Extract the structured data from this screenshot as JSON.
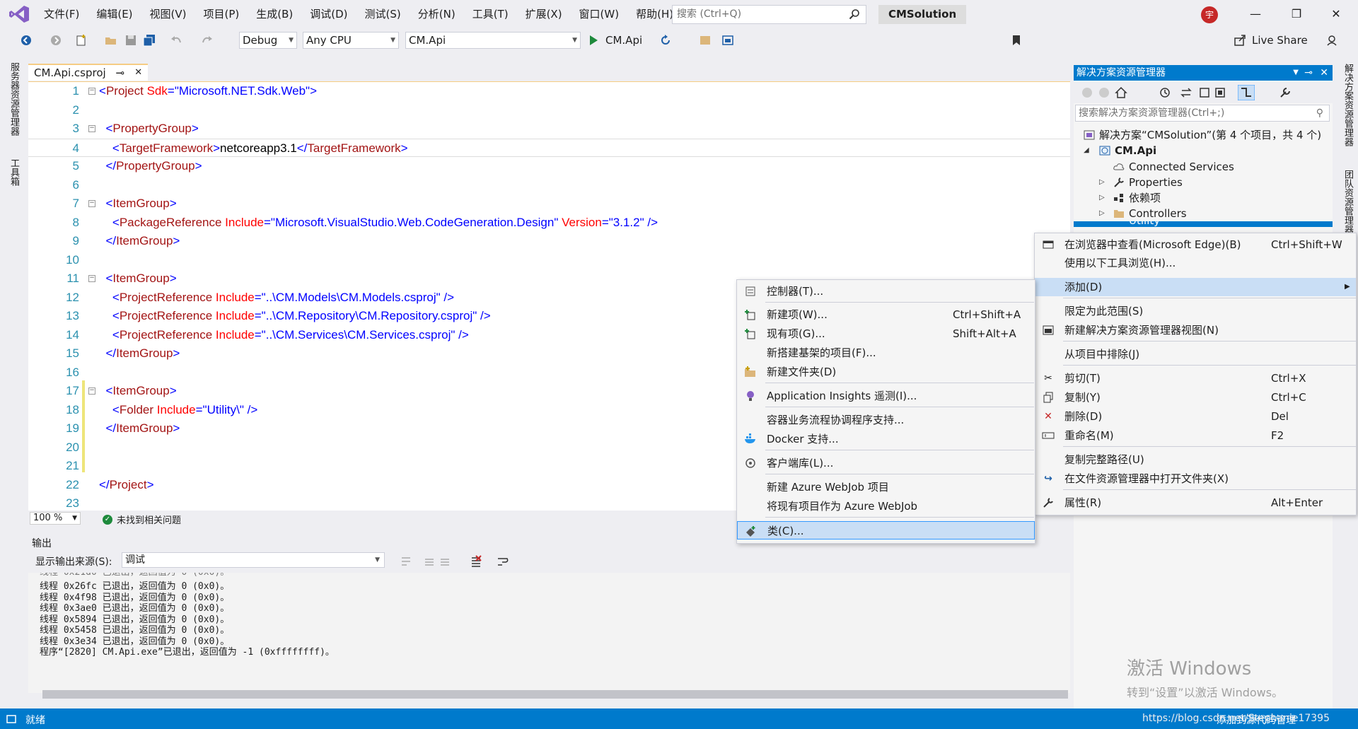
{
  "menubar": {
    "items": [
      "文件(F)",
      "编辑(E)",
      "视图(V)",
      "项目(P)",
      "生成(B)",
      "调试(D)",
      "测试(S)",
      "分析(N)",
      "工具(T)",
      "扩展(X)",
      "窗口(W)",
      "帮助(H)"
    ],
    "search_placeholder": "搜索 (Ctrl+Q)",
    "solution_name": "CMSolution",
    "user_initial": "宇"
  },
  "toolbar": {
    "config": "Debug",
    "platform": "Any CPU",
    "startup_project": "CM.Api",
    "run_label": "CM.Api",
    "live_share": "Live Share"
  },
  "left_strip": {
    "server_explorer": "服务器资源管理器",
    "toolbox": "工具箱"
  },
  "right_strip": {
    "solution_explorer": "解决方案资源管理器",
    "team_explorer": "团队资源管理器"
  },
  "editor": {
    "tab_name": "CM.Api.csproj",
    "lines": [
      {
        "n": "1",
        "parts": [
          [
            "pun",
            "<"
          ],
          [
            "tag",
            "Project"
          ],
          [
            "txt",
            " "
          ],
          [
            "attr",
            "Sdk"
          ],
          [
            "pun",
            "=\""
          ],
          [
            "val",
            "Microsoft.NET.Sdk.Web"
          ],
          [
            "pun",
            "\">"
          ]
        ]
      },
      {
        "n": "2",
        "parts": []
      },
      {
        "n": "3",
        "parts": [
          [
            "txt",
            "  "
          ],
          [
            "pun",
            "<"
          ],
          [
            "tag",
            "PropertyGroup"
          ],
          [
            "pun",
            ">"
          ]
        ]
      },
      {
        "n": "4",
        "parts": [
          [
            "txt",
            "    "
          ],
          [
            "pun",
            "<"
          ],
          [
            "tag",
            "TargetFramework"
          ],
          [
            "pun",
            ">"
          ],
          [
            "txt",
            "netcoreapp3.1"
          ],
          [
            "pun",
            "</"
          ],
          [
            "tag",
            "TargetFramework"
          ],
          [
            "pun",
            ">"
          ]
        ]
      },
      {
        "n": "5",
        "parts": [
          [
            "txt",
            "  "
          ],
          [
            "pun",
            "</"
          ],
          [
            "tag",
            "PropertyGroup"
          ],
          [
            "pun",
            ">"
          ]
        ]
      },
      {
        "n": "6",
        "parts": []
      },
      {
        "n": "7",
        "parts": [
          [
            "txt",
            "  "
          ],
          [
            "pun",
            "<"
          ],
          [
            "tag",
            "ItemGroup"
          ],
          [
            "pun",
            ">"
          ]
        ]
      },
      {
        "n": "8",
        "parts": [
          [
            "txt",
            "    "
          ],
          [
            "pun",
            "<"
          ],
          [
            "tag",
            "PackageReference"
          ],
          [
            "txt",
            " "
          ],
          [
            "attr",
            "Include"
          ],
          [
            "pun",
            "=\""
          ],
          [
            "val",
            "Microsoft.VisualStudio.Web.CodeGeneration.Design"
          ],
          [
            "pun",
            "\""
          ],
          [
            "txt",
            " "
          ],
          [
            "attr",
            "Version"
          ],
          [
            "pun",
            "=\""
          ],
          [
            "val",
            "3.1.2"
          ],
          [
            "pun",
            "\" />"
          ]
        ]
      },
      {
        "n": "9",
        "parts": [
          [
            "txt",
            "  "
          ],
          [
            "pun",
            "</"
          ],
          [
            "tag",
            "ItemGroup"
          ],
          [
            "pun",
            ">"
          ]
        ]
      },
      {
        "n": "10",
        "parts": []
      },
      {
        "n": "11",
        "parts": [
          [
            "txt",
            "  "
          ],
          [
            "pun",
            "<"
          ],
          [
            "tag",
            "ItemGroup"
          ],
          [
            "pun",
            ">"
          ]
        ]
      },
      {
        "n": "12",
        "parts": [
          [
            "txt",
            "    "
          ],
          [
            "pun",
            "<"
          ],
          [
            "tag",
            "ProjectReference"
          ],
          [
            "txt",
            " "
          ],
          [
            "attr",
            "Include"
          ],
          [
            "pun",
            "=\""
          ],
          [
            "val",
            "..\\CM.Models\\CM.Models.csproj"
          ],
          [
            "pun",
            "\" />"
          ]
        ]
      },
      {
        "n": "13",
        "parts": [
          [
            "txt",
            "    "
          ],
          [
            "pun",
            "<"
          ],
          [
            "tag",
            "ProjectReference"
          ],
          [
            "txt",
            " "
          ],
          [
            "attr",
            "Include"
          ],
          [
            "pun",
            "=\""
          ],
          [
            "val",
            "..\\CM.Repository\\CM.Repository.csproj"
          ],
          [
            "pun",
            "\" />"
          ]
        ]
      },
      {
        "n": "14",
        "parts": [
          [
            "txt",
            "    "
          ],
          [
            "pun",
            "<"
          ],
          [
            "tag",
            "ProjectReference"
          ],
          [
            "txt",
            " "
          ],
          [
            "attr",
            "Include"
          ],
          [
            "pun",
            "=\""
          ],
          [
            "val",
            "..\\CM.Services\\CM.Services.csproj"
          ],
          [
            "pun",
            "\" />"
          ]
        ]
      },
      {
        "n": "15",
        "parts": [
          [
            "txt",
            "  "
          ],
          [
            "pun",
            "</"
          ],
          [
            "tag",
            "ItemGroup"
          ],
          [
            "pun",
            ">"
          ]
        ]
      },
      {
        "n": "16",
        "parts": []
      },
      {
        "n": "17",
        "parts": [
          [
            "txt",
            "  "
          ],
          [
            "pun",
            "<"
          ],
          [
            "tag",
            "ItemGroup"
          ],
          [
            "pun",
            ">"
          ]
        ]
      },
      {
        "n": "18",
        "parts": [
          [
            "txt",
            "    "
          ],
          [
            "pun",
            "<"
          ],
          [
            "tag",
            "Folder"
          ],
          [
            "txt",
            " "
          ],
          [
            "attr",
            "Include"
          ],
          [
            "pun",
            "=\""
          ],
          [
            "val",
            "Utility\\"
          ],
          [
            "pun",
            "\" />"
          ]
        ]
      },
      {
        "n": "19",
        "parts": [
          [
            "txt",
            "  "
          ],
          [
            "pun",
            "</"
          ],
          [
            "tag",
            "ItemGroup"
          ],
          [
            "pun",
            ">"
          ]
        ]
      },
      {
        "n": "20",
        "parts": []
      },
      {
        "n": "21",
        "parts": []
      },
      {
        "n": "22",
        "parts": [
          [
            "pun",
            "</"
          ],
          [
            "tag",
            "Project"
          ],
          [
            "pun",
            ">"
          ]
        ]
      },
      {
        "n": "23",
        "parts": []
      }
    ],
    "zoom": "100 %",
    "issues": "未找到相关问题"
  },
  "output": {
    "title": "输出",
    "source_label": "显示输出来源(S):",
    "source_value": "调试",
    "lines": [
      "线程 0x26fc 已退出，返回值为 0 (0x0)。",
      "线程 0x4f98 已退出，返回值为 0 (0x0)。",
      "线程 0x3ae0 已退出，返回值为 0 (0x0)。",
      "线程 0x5894 已退出，返回值为 0 (0x0)。",
      "线程 0x5458 已退出，返回值为 0 (0x0)。",
      "线程 0x3e34 已退出，返回值为 0 (0x0)。",
      "程序“[2820] CM.Api.exe”已退出，返回值为 -1 (0xffffffff)。"
    ]
  },
  "solution_explorer": {
    "title": "解决方案资源管理器",
    "search_placeholder": "搜索解决方案资源管理器(Ctrl+;)",
    "solution_item": "解决方案“CMSolution”(第 4 个项目，共 4 个)",
    "project": "CM.Api",
    "items": [
      "Connected Services",
      "Properties",
      "依赖项",
      "Controllers",
      "Utility"
    ]
  },
  "context_menu_main": {
    "items": [
      {
        "label": "在浏览器中查看(Microsoft Edge)(B)",
        "shortcut": "Ctrl+Shift+W"
      },
      {
        "label": "使用以下工具浏览(H)...",
        "shortcut": ""
      },
      {
        "label": "添加(D)",
        "shortcut": ""
      },
      {
        "label": "限定为此范围(S)",
        "shortcut": ""
      },
      {
        "label": "新建解决方案资源管理器视图(N)",
        "shortcut": ""
      },
      {
        "label": "从项目中排除(J)",
        "shortcut": ""
      },
      {
        "label": "剪切(T)",
        "shortcut": "Ctrl+X"
      },
      {
        "label": "复制(Y)",
        "shortcut": "Ctrl+C"
      },
      {
        "label": "删除(D)",
        "shortcut": "Del"
      },
      {
        "label": "重命名(M)",
        "shortcut": "F2"
      },
      {
        "label": "复制完整路径(U)",
        "shortcut": ""
      },
      {
        "label": "在文件资源管理器中打开文件夹(X)",
        "shortcut": ""
      },
      {
        "label": "属性(R)",
        "shortcut": "Alt+Enter"
      }
    ]
  },
  "context_menu_add": {
    "items": [
      {
        "label": "控制器(T)...",
        "shortcut": ""
      },
      {
        "label": "新建项(W)...",
        "shortcut": "Ctrl+Shift+A"
      },
      {
        "label": "现有项(G)...",
        "shortcut": "Shift+Alt+A"
      },
      {
        "label": "新搭建基架的项目(F)...",
        "shortcut": ""
      },
      {
        "label": "新建文件夹(D)",
        "shortcut": ""
      },
      {
        "label": "Application Insights 遥测(I)...",
        "shortcut": ""
      },
      {
        "label": "容器业务流程协调程序支持...",
        "shortcut": ""
      },
      {
        "label": "Docker 支持...",
        "shortcut": ""
      },
      {
        "label": "客户端库(L)...",
        "shortcut": ""
      },
      {
        "label": "新建 Azure WebJob 项目",
        "shortcut": ""
      },
      {
        "label": "将现有项目作为 Azure WebJob",
        "shortcut": ""
      },
      {
        "label": "类(C)...",
        "shortcut": ""
      }
    ]
  },
  "statusbar": {
    "ready": "就绪",
    "url": "https://blog.csdn.net/Stephanie17395",
    "add_source": "添加到源代码管理"
  },
  "watermark": {
    "line1": "激活 Windows",
    "line2": "转到“设置”以激活 Windows。"
  },
  "colors": {
    "accent": "#007acc",
    "menu_highlight": "#c9def5",
    "xml_tag": "#a31515",
    "xml_attr": "#ff0000",
    "xml_value": "#0000ff"
  }
}
